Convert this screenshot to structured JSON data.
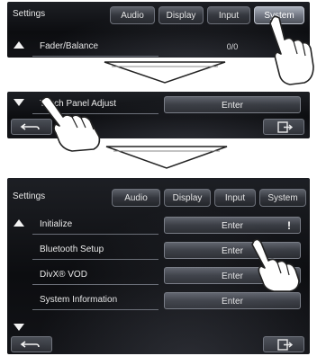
{
  "panel1": {
    "settings_label": "Settings",
    "tabs": [
      {
        "label": "Audio",
        "active": false
      },
      {
        "label": "Display",
        "active": false
      },
      {
        "label": "Input",
        "active": false
      },
      {
        "label": "System",
        "active": true
      }
    ],
    "row": {
      "label": "Fader/Balance",
      "value": "0/0"
    }
  },
  "panel2": {
    "row": {
      "label": "Touch Panel Adjust",
      "button": "Enter"
    }
  },
  "panel3": {
    "settings_label": "Settings",
    "tabs": [
      {
        "label": "Audio",
        "active": false
      },
      {
        "label": "Display",
        "active": false
      },
      {
        "label": "Input",
        "active": false
      },
      {
        "label": "System",
        "active": false
      }
    ],
    "rows": [
      {
        "label": "Initialize",
        "button": "Enter",
        "alert": "!"
      },
      {
        "label": "Bluetooth Setup",
        "button": "Enter"
      },
      {
        "label": "DivX® VOD",
        "button": "Enter"
      },
      {
        "label": "System Information",
        "button": "Enter"
      }
    ]
  },
  "icons": [
    "scroll-up-icon",
    "scroll-down-icon",
    "back-icon",
    "exit-icon",
    "hand-pointer-icon",
    "down-arrow-icon"
  ],
  "colors": {
    "panel_bg": "#0c0d10",
    "button_bg": "#3a3d44",
    "active_tab": "#8a8f9a",
    "text": "#eaeaea"
  }
}
